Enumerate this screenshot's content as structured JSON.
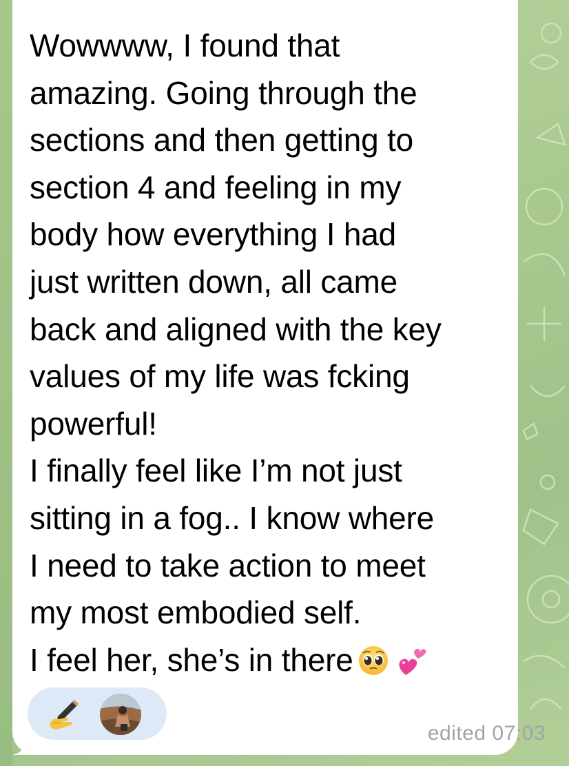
{
  "chat": {
    "message": {
      "lines": [
        "Wowwww, I found that",
        "amazing. Going through the",
        "sections and then getting to",
        "section 4 and feeling in my",
        "body how everything I had",
        "just written down, all came",
        "back and aligned with the key",
        "values of my life was fcking",
        "powerful!",
        "I finally feel like I’m not just",
        "sitting in a fog.. I know where",
        "I need to take action to meet",
        "my most embodied self.",
        "I feel her, she’s in there"
      ],
      "end_emojis": [
        "pleading-face-icon",
        "two-hearts-icon"
      ],
      "status": "edited 07:03"
    },
    "reaction": {
      "emoji": "writing-hand-icon"
    },
    "colors": {
      "bubble": "#ffffff",
      "text": "#000000",
      "timestamp": "#a0a4a9",
      "reaction_pill": "#dde9f7",
      "wallpaper": "#a9c98f"
    }
  }
}
